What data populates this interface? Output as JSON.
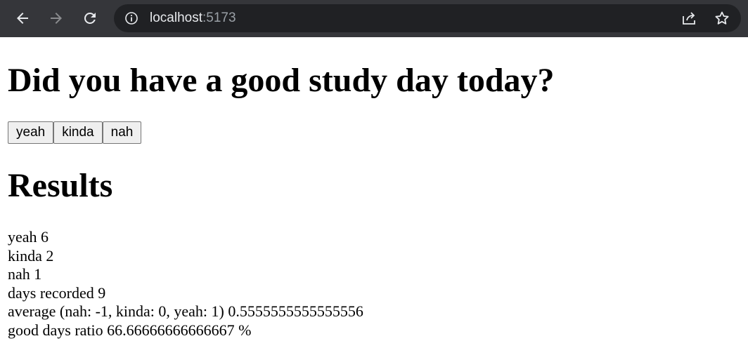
{
  "browser": {
    "url_host": "localhost",
    "url_port": ":5173",
    "icons": [
      "back-arrow-icon",
      "forward-arrow-icon",
      "reload-icon",
      "info-icon",
      "share-icon",
      "star-icon"
    ]
  },
  "page": {
    "question": "Did you have a good study day today?",
    "buttons": {
      "good": "yeah",
      "neutral": "kinda",
      "bad": "nah"
    },
    "results_heading": "Results",
    "results": [
      {
        "label": "yeah",
        "value": "6"
      },
      {
        "label": "kinda",
        "value": "2"
      },
      {
        "label": "nah",
        "value": "1"
      },
      {
        "label": "days recorded",
        "value": "9"
      },
      {
        "label": "average (nah: -1, kinda: 0, yeah: 1)",
        "value": "0.5555555555555556"
      },
      {
        "label": "good days ratio",
        "value": "66.66666666666667 %"
      }
    ]
  }
}
